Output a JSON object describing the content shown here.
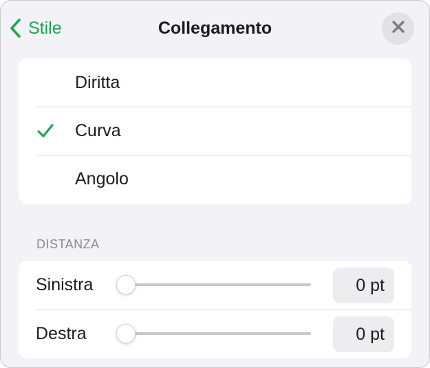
{
  "header": {
    "back_label": "Stile",
    "title": "Collegamento",
    "back_icon": "chevron-left-icon",
    "close_icon": "close-icon"
  },
  "connection_types": {
    "selected_index": 1,
    "items": [
      {
        "label": "Diritta"
      },
      {
        "label": "Curva"
      },
      {
        "label": "Angolo"
      }
    ]
  },
  "distance": {
    "section_label": "DISTANZA",
    "rows": [
      {
        "label": "Sinistra",
        "value": "0 pt",
        "slider_fraction": 0
      },
      {
        "label": "Destra",
        "value": "0 pt",
        "slider_fraction": 0
      }
    ]
  },
  "colors": {
    "accent": "#1aa84d",
    "background": "#f2f2f7",
    "card": "#ffffff",
    "secondary_text": "#8a8a8e"
  }
}
